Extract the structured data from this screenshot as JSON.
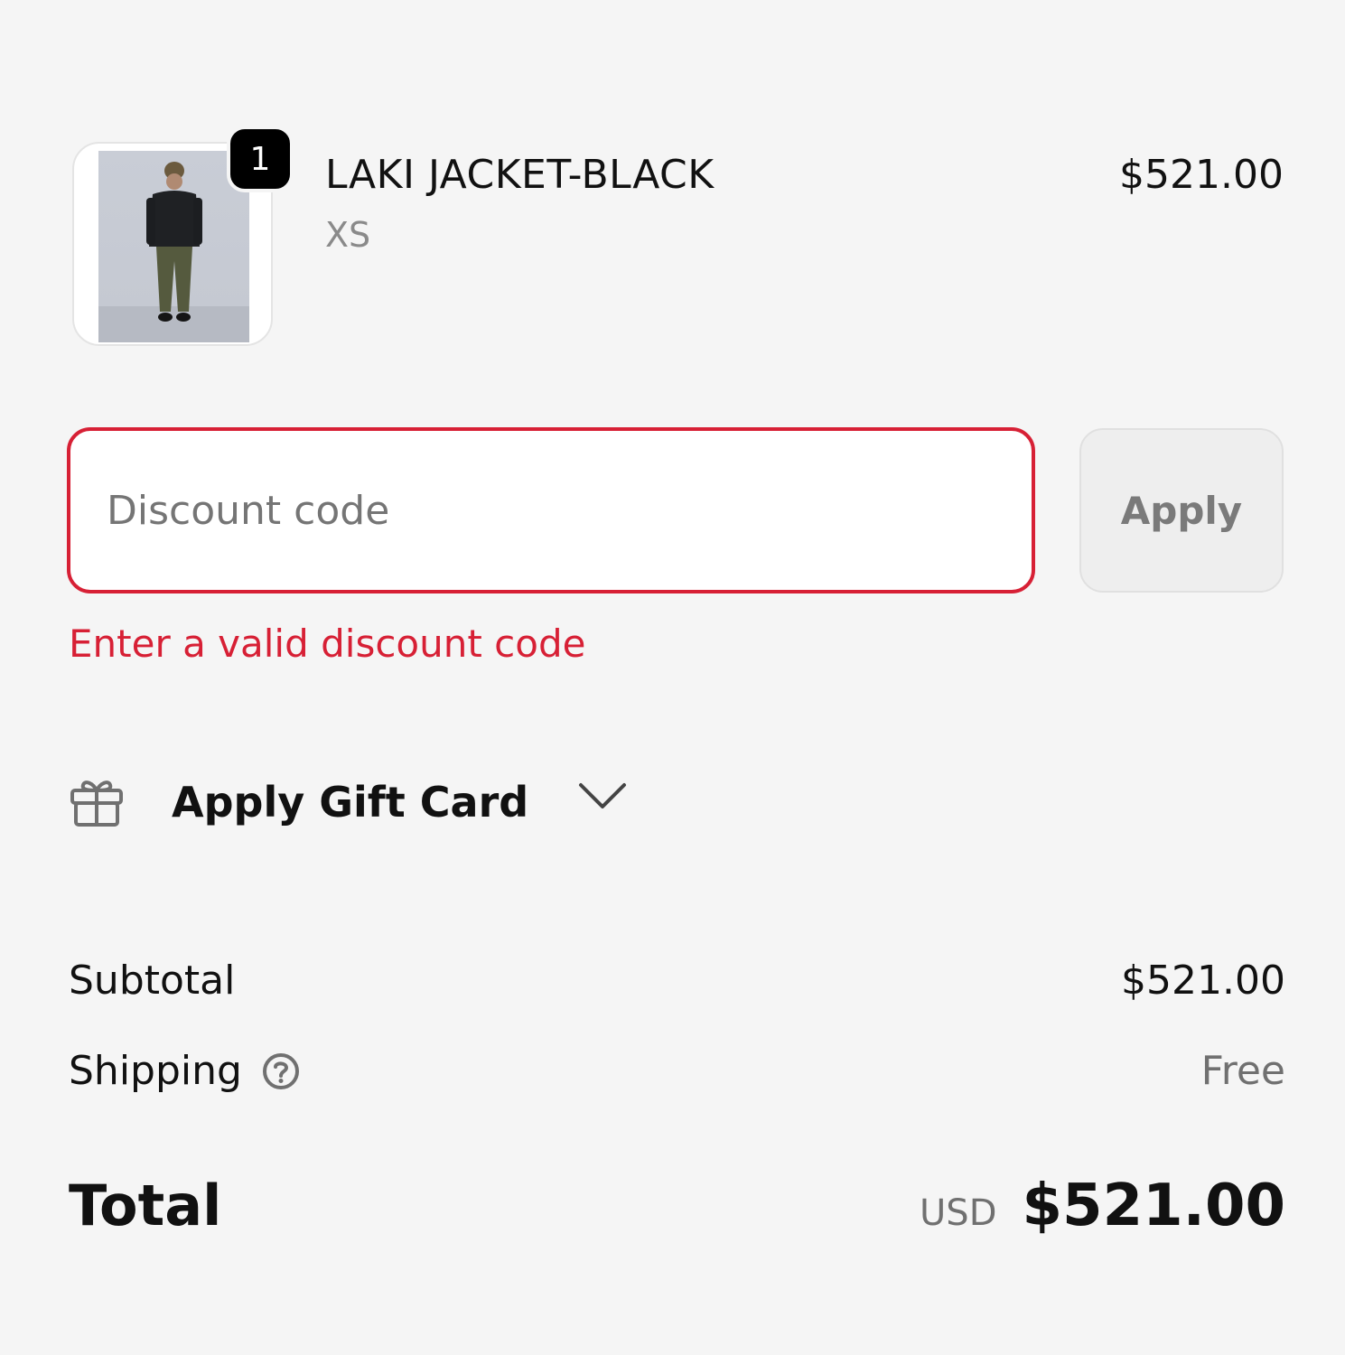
{
  "line_item": {
    "quantity": "1",
    "name": "LAKI JACKET-BLACK",
    "variant": "XS",
    "price": "$521.00"
  },
  "discount": {
    "placeholder": "Discount code",
    "value": "",
    "apply_label": "Apply",
    "error": "Enter a valid discount code"
  },
  "gift_card": {
    "label": "Apply Gift Card",
    "icon": "gift-icon",
    "toggle_icon": "chevron-down-icon"
  },
  "summary": {
    "subtotal_label": "Subtotal",
    "subtotal_value": "$521.00",
    "shipping_label": "Shipping",
    "shipping_value": "Free",
    "total_label": "Total",
    "currency": "USD",
    "total_value": "$521.00"
  },
  "colors": {
    "background": "#f5f5f5",
    "error": "#d72035",
    "text": "#111111",
    "muted": "#707070",
    "button_bg": "#eeeeee"
  }
}
